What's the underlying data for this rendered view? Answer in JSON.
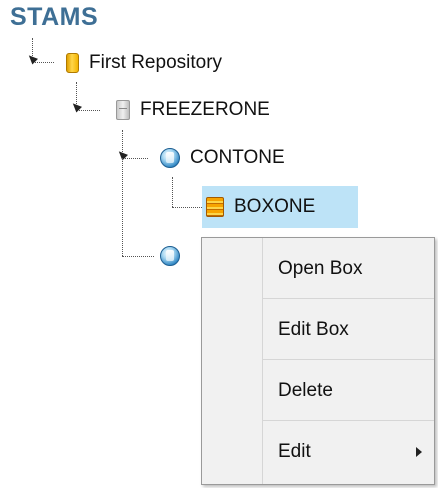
{
  "app": {
    "title": "STAMS"
  },
  "tree": {
    "repository": {
      "label": "First Repository",
      "icon": "repository-icon"
    },
    "freezer": {
      "label": "FREEZERONE",
      "icon": "freezer-icon"
    },
    "container": {
      "label": "CONTONE",
      "icon": "container-icon"
    },
    "box": {
      "label": "BOXONE",
      "icon": "box-icon",
      "selected": true
    },
    "container2": {
      "label": "",
      "icon": "container-icon"
    }
  },
  "context_menu": {
    "items": [
      {
        "label": "Open Box"
      },
      {
        "label": "Edit Box"
      },
      {
        "label": "Delete"
      },
      {
        "label": "Edit",
        "has_submenu": true
      }
    ]
  },
  "colors": {
    "title": "#3e6f95",
    "selection": "#bde3f7",
    "menu_background": "#f1f1f1"
  }
}
